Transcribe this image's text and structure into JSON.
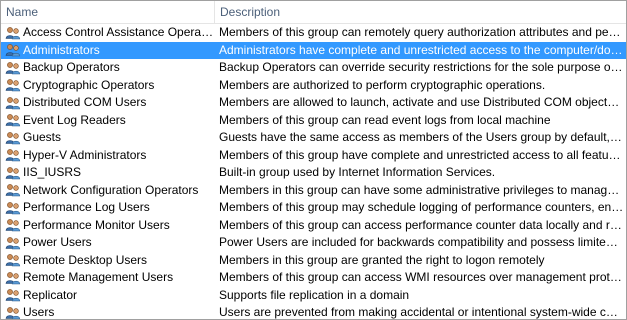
{
  "columns": {
    "name": "Name",
    "description": "Description"
  },
  "icon": "group-users-icon",
  "selection_color": "#3399ff",
  "rows": [
    {
      "name": "Access Control Assistance Operators",
      "description": "Members of this group can remotely query authorization attributes and permissi...",
      "selected": false
    },
    {
      "name": "Administrators",
      "description": "Administrators have complete and unrestricted access to the computer/domain",
      "selected": true
    },
    {
      "name": "Backup Operators",
      "description": "Backup Operators can override security restrictions for the sole purpose of backin...",
      "selected": false
    },
    {
      "name": "Cryptographic Operators",
      "description": "Members are authorized to perform cryptographic operations.",
      "selected": false
    },
    {
      "name": "Distributed COM Users",
      "description": "Members are allowed to launch, activate and use Distributed COM objects on thi...",
      "selected": false
    },
    {
      "name": "Event Log Readers",
      "description": "Members of this group can read event logs from local machine",
      "selected": false
    },
    {
      "name": "Guests",
      "description": "Guests have the same access as members of the Users group by default, except f...",
      "selected": false
    },
    {
      "name": "Hyper-V Administrators",
      "description": "Members of this group have complete and unrestricted access to all features of ...",
      "selected": false
    },
    {
      "name": "IIS_IUSRS",
      "description": "Built-in group used by Internet Information Services.",
      "selected": false
    },
    {
      "name": "Network Configuration Operators",
      "description": "Members in this group can have some administrative privileges to manage confi...",
      "selected": false
    },
    {
      "name": "Performance Log Users",
      "description": "Members of this group may schedule logging of performance counters, enable tr...",
      "selected": false
    },
    {
      "name": "Performance Monitor Users",
      "description": "Members of this group can access performance counter data locally and remotely",
      "selected": false
    },
    {
      "name": "Power Users",
      "description": "Power Users are included for backwards compatibility and possess limited admin...",
      "selected": false
    },
    {
      "name": "Remote Desktop Users",
      "description": "Members in this group are granted the right to logon remotely",
      "selected": false
    },
    {
      "name": "Remote Management Users",
      "description": "Members of this group can access WMI resources over management protocols (s...",
      "selected": false
    },
    {
      "name": "Replicator",
      "description": "Supports file replication in a domain",
      "selected": false
    },
    {
      "name": "Users",
      "description": "Users are prevented from making accidental or intentional system-wide changes ...",
      "selected": false
    }
  ]
}
